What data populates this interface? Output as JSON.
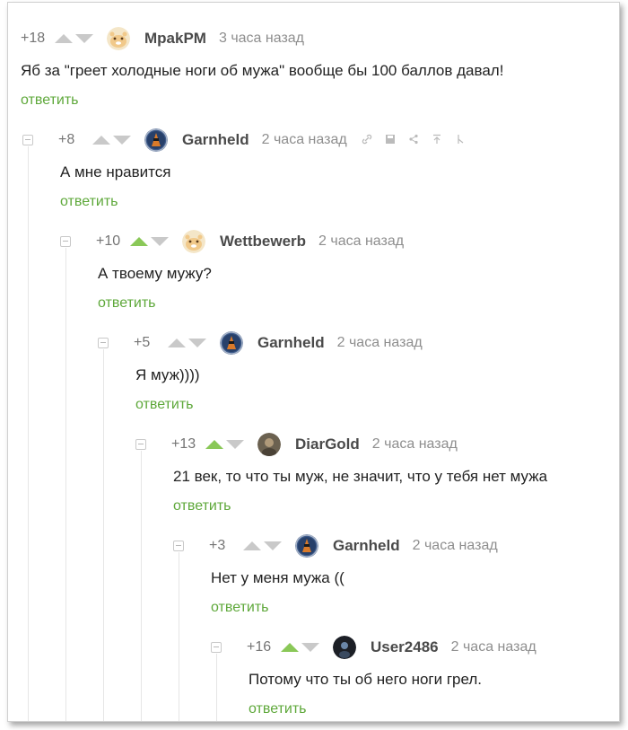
{
  "comments": [
    {
      "rating": "+18",
      "up_active": false,
      "nick": "MpakPM",
      "time": "3 часа назад",
      "text": "Яб за \"греет холодные ноги об мужа\" вообще бы 100 баллов давал!",
      "reply": "ответить",
      "avatar": "hamster"
    },
    {
      "rating": "+8",
      "up_active": false,
      "nick": "Garnheld",
      "time": "2 часа назад",
      "text": "А мне нравится",
      "reply": "ответить",
      "avatar": "knight"
    },
    {
      "rating": "+10",
      "up_active": true,
      "nick": "Wettbewerb",
      "time": "2 часа назад",
      "text": "А твоему мужу?",
      "reply": "ответить",
      "avatar": "hamster"
    },
    {
      "rating": "+5",
      "up_active": false,
      "nick": "Garnheld",
      "time": "2 часа назад",
      "text": "Я муж))))",
      "reply": "ответить",
      "avatar": "knight"
    },
    {
      "rating": "+13",
      "up_active": true,
      "nick": "DiarGold",
      "time": "2 часа назад",
      "text": "21 век, то что ты муж, не значит, что у тебя нет мужа",
      "reply": "ответить",
      "avatar": "photo"
    },
    {
      "rating": "+3",
      "up_active": false,
      "nick": "Garnheld",
      "time": "2 часа назад",
      "text": "Нет у меня мужа ((",
      "reply": "ответить",
      "avatar": "knight"
    },
    {
      "rating": "+16",
      "up_active": true,
      "nick": "User2486",
      "time": "2 часа назад",
      "text": "Потому что ты об него ноги грел.",
      "reply": "ответить",
      "avatar": "dark"
    }
  ],
  "toolbar_icons": [
    "link-icon",
    "save-icon",
    "share-icon",
    "scroll-up-icon",
    "branch-icon"
  ],
  "colors": {
    "accent_green": "#5ea83a",
    "upvote_active": "#8ac858",
    "arrow_inactive": "#c9c9c9"
  }
}
